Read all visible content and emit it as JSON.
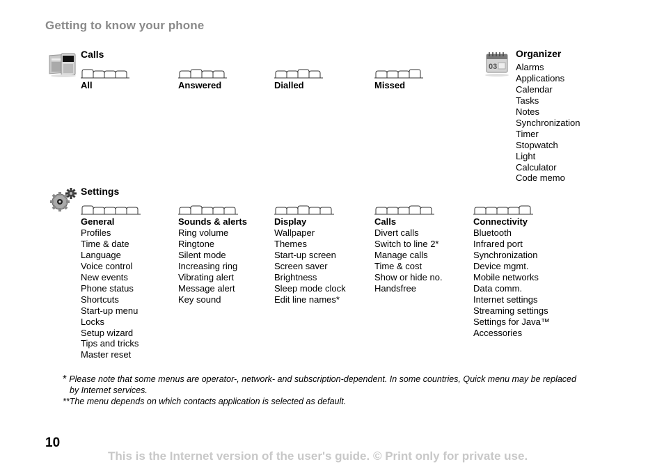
{
  "page": {
    "title": "Getting to know your phone",
    "page_number": "10",
    "notice": "This is the Internet version of the user's guide. © Print only for private use."
  },
  "calls": {
    "icon": "calls-phone-icon",
    "title": "Calls",
    "tabs": [
      {
        "label": "All",
        "tab_count": 4,
        "active_tab": 1
      },
      {
        "label": "Answered",
        "tab_count": 4,
        "active_tab": 2
      },
      {
        "label": "Dialled",
        "tab_count": 4,
        "active_tab": 3
      },
      {
        "label": "Missed",
        "tab_count": 4,
        "active_tab": 4
      }
    ]
  },
  "organizer": {
    "icon": "calendar-icon",
    "title": "Organizer",
    "items": [
      "Alarms",
      "Applications",
      "Calendar",
      "Tasks",
      "Notes",
      "Synchronization",
      "Timer",
      "Stopwatch",
      "Light",
      "Calculator",
      "Code memo"
    ]
  },
  "settings": {
    "icon": "gears-icon",
    "title": "Settings",
    "tabs": [
      {
        "label": "General",
        "tab_count": 5,
        "active_tab": 1,
        "items": [
          "Profiles",
          "Time & date",
          "Language",
          "Voice control",
          "New events",
          "Phone status",
          "Shortcuts",
          "Start-up menu",
          "Locks",
          "Setup wizard",
          "Tips and tricks",
          "Master reset"
        ]
      },
      {
        "label": "Sounds & alerts",
        "tab_count": 5,
        "active_tab": 2,
        "items": [
          "Ring volume",
          "Ringtone",
          "Silent mode",
          "Increasing ring",
          "Vibrating alert",
          "Message alert",
          "Key sound"
        ]
      },
      {
        "label": "Display",
        "tab_count": 5,
        "active_tab": 3,
        "items": [
          "Wallpaper",
          "Themes",
          "Start-up screen",
          "Screen saver",
          "Brightness",
          "Sleep mode clock",
          "Edit line names*"
        ]
      },
      {
        "label": "Calls",
        "tab_count": 5,
        "active_tab": 4,
        "items": [
          "Divert calls",
          "Switch to line 2*",
          "Manage calls",
          "Time & cost",
          "Show or hide no.",
          "Handsfree"
        ]
      },
      {
        "label": "Connectivity",
        "tab_count": 5,
        "active_tab": 5,
        "items": [
          "Bluetooth",
          "Infrared port",
          "Synchronization",
          "Device mgmt.",
          "Mobile networks",
          "Data comm.",
          "Internet settings",
          "Streaming settings",
          "Settings for Java™",
          "Accessories"
        ]
      }
    ]
  },
  "footnotes": {
    "star": "*",
    "note1_line1": " Please note that some menus are operator-, network- and subscription-dependent. In some countries, Quick menu may be replaced",
    "note1_line2": "by Internet services.",
    "note2": "**The menu depends on which contacts application is selected as default."
  }
}
